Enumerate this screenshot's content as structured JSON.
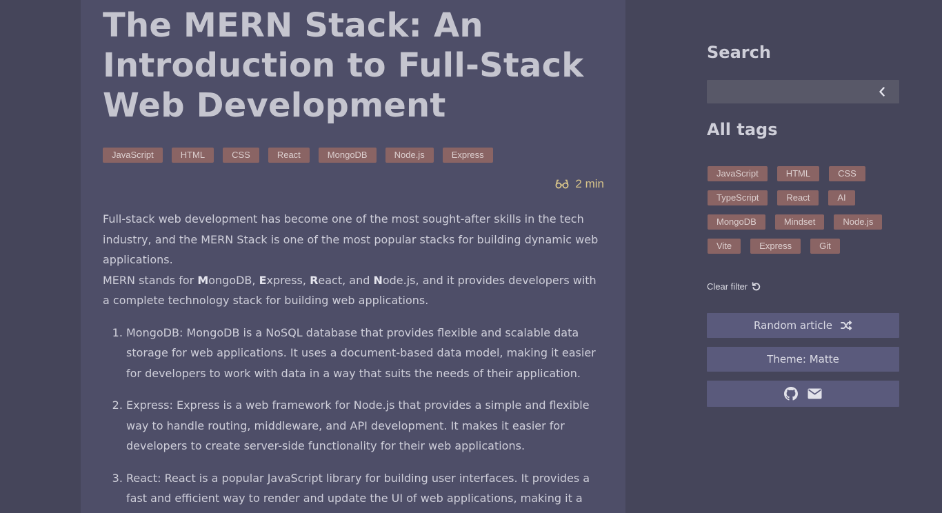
{
  "article": {
    "title": "The MERN Stack: An Introduction to Full-Stack Web Development",
    "tags": [
      "JavaScript",
      "HTML",
      "CSS",
      "React",
      "MongoDB",
      "Node.js",
      "Express"
    ],
    "read_time": "2 min",
    "intro_p1": "Full-stack web development has become one of the most sought-after skills in the tech industry, and the MERN Stack is one of the most popular stacks for building dynamic web applications.",
    "intro_p2": {
      "prefix": "MERN stands for ",
      "m": "M",
      "m_rest": "ongoDB, ",
      "e": "E",
      "e_rest": "xpress, ",
      "r": "R",
      "r_rest": "eact, and ",
      "n": "N",
      "n_rest": "ode.js, and it provides developers with a complete technology stack for building web applications."
    },
    "list_items": [
      "MongoDB: MongoDB is a NoSQL database that provides flexible and scalable data storage for web applications. It uses a document-based data model, making it easier for developers to work with data in a way that suits the needs of their application.",
      "Express: Express is a web framework for Node.js that provides a simple and flexible way to handle routing, middleware, and API development. It makes it easier for developers to create server-side functionality for their web applications.",
      "React: React is a popular JavaScript library for building user interfaces. It provides a fast and efficient way to render and update the UI of web applications, making it a crucial"
    ]
  },
  "sidebar": {
    "search_heading": "Search",
    "search_placeholder": "",
    "tags_heading": "All tags",
    "all_tags": [
      "JavaScript",
      "HTML",
      "CSS",
      "TypeScript",
      "React",
      "AI",
      "MongoDB",
      "Mindset",
      "Node.js",
      "Vite",
      "Express",
      "Git"
    ],
    "clear_filter": "Clear filter",
    "random_article": "Random article",
    "theme": "Theme: Matte"
  },
  "icons": {
    "read_time": "glasses-icon",
    "search": "chevron-left-icon",
    "clear": "refresh-icon",
    "random": "shuffle-icon",
    "github": "github-icon",
    "email": "envelope-icon"
  },
  "colors": {
    "background": "#45455a",
    "article_bg": "#4e4e68",
    "tag_bg": "#8a6464",
    "button_bg": "#5a5a7c",
    "read_time": "#d8c48a"
  }
}
